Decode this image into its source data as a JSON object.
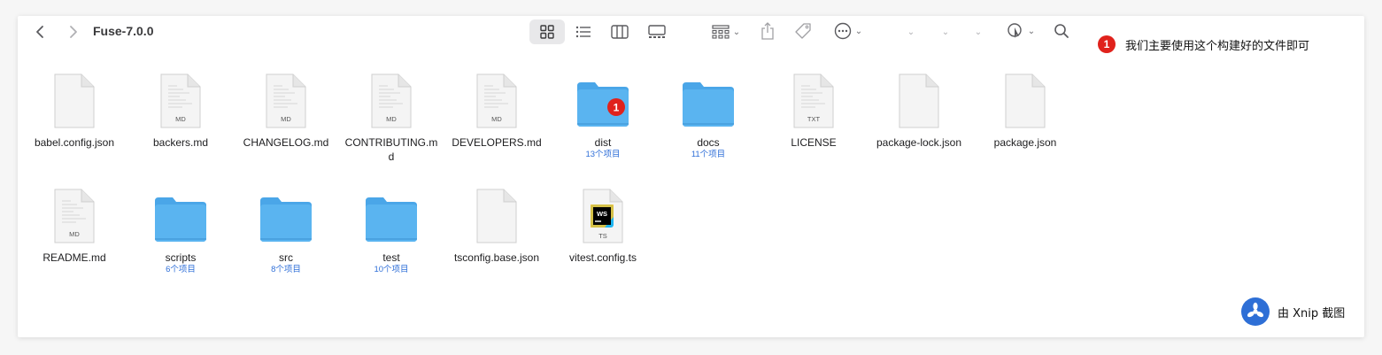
{
  "window": {
    "title": "Fuse-7.0.0"
  },
  "toolbar": {
    "back": "back",
    "forward": "forward",
    "icons": [
      "grid-view-icon",
      "list-view-icon",
      "column-view-icon",
      "gallery-view-icon",
      "group-icon",
      "share-icon",
      "tag-icon",
      "more-icon",
      "dropdown-icon",
      "dropdown-icon",
      "dropdown-icon",
      "airdrop-icon",
      "search-icon"
    ]
  },
  "annotation": {
    "badge": "1",
    "text": "我们主要使用这个构建好的文件即可"
  },
  "files": [
    {
      "name": "babel.config.json",
      "kind": "doc",
      "label": "",
      "count": ""
    },
    {
      "name": "backers.md",
      "kind": "doc",
      "label": "MD",
      "count": ""
    },
    {
      "name": "CHANGELOG.md",
      "kind": "doc",
      "label": "MD",
      "count": ""
    },
    {
      "name": "CONTRIBUTING.md",
      "kind": "doc",
      "label": "MD",
      "count": ""
    },
    {
      "name": "DEVELOPERS.md",
      "kind": "doc",
      "label": "MD",
      "count": ""
    },
    {
      "name": "dist",
      "kind": "folder",
      "label": "1",
      "count": "13个项目"
    },
    {
      "name": "docs",
      "kind": "folder",
      "label": "",
      "count": "11个项目"
    },
    {
      "name": "LICENSE",
      "kind": "doc",
      "label": "TXT",
      "count": ""
    },
    {
      "name": "package-lock.json",
      "kind": "doc",
      "label": "",
      "count": ""
    },
    {
      "name": "package.json",
      "kind": "doc",
      "label": "",
      "count": ""
    },
    {
      "name": "README.md",
      "kind": "doc",
      "label": "MD",
      "count": ""
    },
    {
      "name": "scripts",
      "kind": "folder",
      "label": "",
      "count": "6个项目"
    },
    {
      "name": "src",
      "kind": "folder",
      "label": "",
      "count": "8个项目"
    },
    {
      "name": "test",
      "kind": "folder",
      "label": "",
      "count": "10个项目"
    },
    {
      "name": "tsconfig.base.json",
      "kind": "doc",
      "label": "",
      "count": ""
    },
    {
      "name": "vitest.config.ts",
      "kind": "ws",
      "label": "TS",
      "count": ""
    }
  ],
  "watermark": {
    "text": "由 Xnip 截图"
  },
  "colors": {
    "folder": "#5ab4f0",
    "folder_tab": "#4aa6e8",
    "badge": "#e0221c",
    "count_text": "#2f6fd8"
  }
}
